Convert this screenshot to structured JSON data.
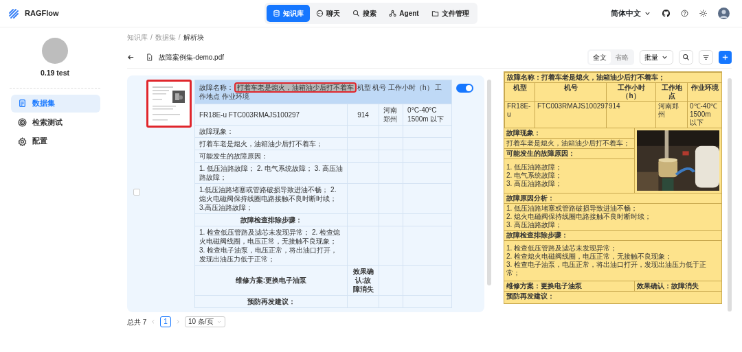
{
  "nav": {
    "brand": "RAGFlow",
    "language": "简体中文",
    "tabs": [
      {
        "label": "知识库",
        "selected": true
      },
      {
        "label": "聊天",
        "selected": false
      },
      {
        "label": "搜索",
        "selected": false
      },
      {
        "label": "Agent",
        "selected": false
      },
      {
        "label": "文件管理",
        "selected": false
      }
    ]
  },
  "sidebar": {
    "name": "0.19 test",
    "items": [
      {
        "label": "数据集",
        "selected": true
      },
      {
        "label": "检索测试",
        "selected": false
      },
      {
        "label": "配置",
        "selected": false
      }
    ]
  },
  "breadcrumb": [
    {
      "kind": "link",
      "text": "知识库"
    },
    {
      "kind": "separator",
      "text": "/"
    },
    {
      "kind": "link",
      "text": "数据集"
    },
    {
      "kind": "separator",
      "text": "/"
    },
    {
      "kind": "current",
      "text": "解析块"
    }
  ],
  "file": {
    "name": "故障案例集-demo.pdf"
  },
  "view_modes": [
    {
      "label": "全文",
      "selected": true
    },
    {
      "label": "省略",
      "selected": false
    }
  ],
  "bulk": {
    "label": "批量"
  },
  "chunk": {
    "checked": false,
    "enabled": true,
    "thumbnail_highlighted": true,
    "title_parts": [
      {
        "text": "故障名称：",
        "highlighted": false
      },
      {
        "text": "打着车老是熄火，油箱油少后打不着车",
        "highlighted": true
      },
      {
        "text": "机型 机号 工作小时（h） 工作地点 作业环境",
        "highlighted": false
      }
    ],
    "rows": [
      {
        "bold": false,
        "cells": [
          "FR18E-u FTC003RMAJS100297",
          "914",
          "河南郑州",
          "0°C-40°C 1500m 以下"
        ]
      },
      {
        "bold": false,
        "cells": [
          "故障现象："
        ]
      },
      {
        "bold": false,
        "cells": [
          "打着车老是熄火，油箱油少后打不着车；"
        ]
      },
      {
        "bold": false,
        "cells": [
          "可能发生的故障原因："
        ]
      },
      {
        "bold": false,
        "cells": [
          "1. 低压油路故障； 2. 电气系统故障； 3. 高压油路故障；"
        ]
      },
      {
        "bold": false,
        "cells": [
          "1.低压油路堵塞或管路破损导致进油不畅； 2.熄火电磁阀保持线圈电路接触不良时断时续； 3.高压油路故障；"
        ]
      },
      {
        "bold": true,
        "cells": [
          "故障检查排除步骤："
        ]
      },
      {
        "bold": false,
        "cells": [
          "1. 检查低压管路及滤芯未发现异常； 2. 检查熄火电磁阀线圈，电压正常，无接触不良现象； 3. 检查电子油泵，电压正常，将出油口打开，发现出油压力低于正常；"
        ]
      },
      {
        "bold": true,
        "cells": [
          "维修方案:更换电子油泵",
          "效果确认:故障消失"
        ]
      },
      {
        "bold": true,
        "cells": [
          "预防再发建议："
        ]
      }
    ]
  },
  "pagination": {
    "total": "总共 7",
    "pages": [
      {
        "label": "1",
        "selected": true
      }
    ],
    "page_size": "10 条/页"
  },
  "preview": {
    "title": "故障名称：打着车老是熄火，油箱油少后打不着车；",
    "headers": [
      "机型",
      "机号",
      "工作小时（h）",
      "工作地点",
      "作业环境"
    ],
    "values": [
      "FR18E-u",
      "FTC003RMAJS100297",
      "914",
      "河南郑州",
      "0℃-40℃ 1500m 以下"
    ],
    "left_lines": [
      {
        "text": "故障现象：",
        "bold": true
      },
      {
        "text": "打着车老是熄火，油箱油少后打不着车；",
        "bold": false
      },
      {
        "text": "可能发生的故障原因：",
        "bold": true
      }
    ],
    "causes": [
      "1. 低压油路故障；",
      "2. 电气系统故障；",
      "3. 高压油路故障；"
    ],
    "analysis_title": "故障原因分析：",
    "analysis": [
      "1. 低压油路堵塞或管路破损导致进油不畅；",
      "2. 熄火电磁阀保持线圈电路接触不良时断时续；",
      "3. 高压油路故障；"
    ],
    "steps_title": "故障检查排除步骤：",
    "steps": [
      "1. 检查低压管路及滤芯未发现异常；",
      "2. 检查熄火电磁阀线圈，电压正常，无接触不良现象；",
      "3. 检查电子油泵，电压正常，将出油口打开，发现出油压力低于正常；"
    ],
    "fix": "维修方案：更换电子油泵",
    "result": "效果确认：故障消失",
    "prevent": "预防再发建议："
  }
}
